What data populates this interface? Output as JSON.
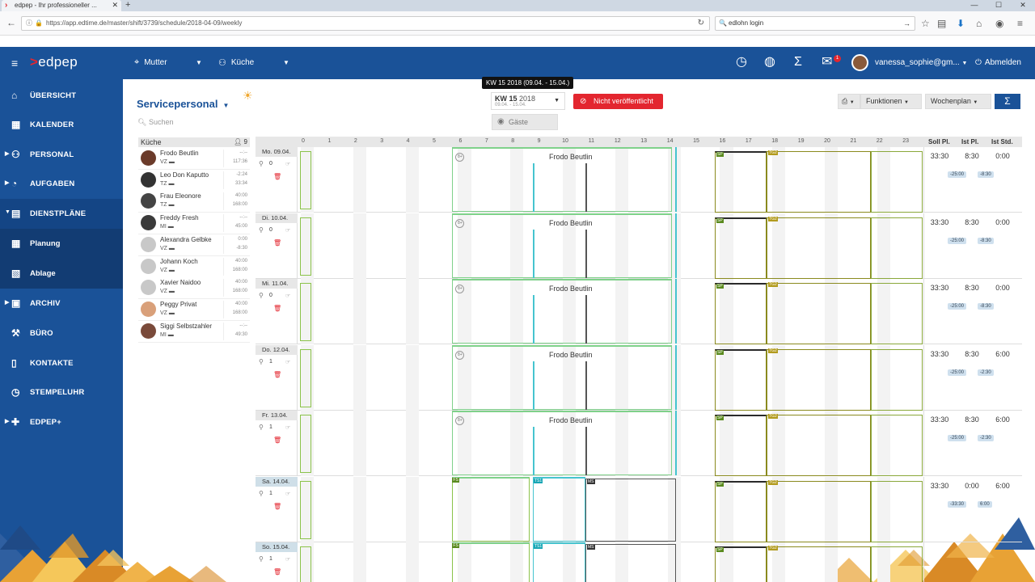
{
  "browser": {
    "tab_title": "edpep - Ihr professioneller ...",
    "new_tab": "+",
    "url": "https://app.edtime.de/master/shift/3739/schedule/2018-04-09/weekly",
    "search_text": "edlohn login"
  },
  "app": {
    "logo_prefix": ">",
    "logo_text": "edpep",
    "location": "Mutter",
    "department": "Küche",
    "notif_count": "1",
    "user": "vanessa_sophie@gm...",
    "logout": "Abmelden"
  },
  "sidebar": {
    "items": [
      {
        "label": "ÜBERSICHT",
        "icon": "home-icon"
      },
      {
        "label": "KALENDER",
        "icon": "calendar-icon"
      },
      {
        "label": "PERSONAL",
        "icon": "people-icon"
      },
      {
        "label": "AUFGABEN",
        "icon": "tasks-icon"
      },
      {
        "label": "DIENSTPLÄNE",
        "icon": "schedule-icon"
      },
      {
        "label": "Planung",
        "icon": "planning-icon"
      },
      {
        "label": "Ablage",
        "icon": "archive-tray-icon"
      },
      {
        "label": "ARCHIV",
        "icon": "archive-icon"
      },
      {
        "label": "BÜRO",
        "icon": "office-icon"
      },
      {
        "label": "KONTAKTE",
        "icon": "contacts-icon"
      },
      {
        "label": "STEMPELUHR",
        "icon": "clock-icon"
      },
      {
        "label": "EDPEP+",
        "icon": "plus-icon"
      }
    ]
  },
  "main": {
    "title": "Servicepersonal",
    "search_placeholder": "Suchen",
    "tooltip": "KW 15 2018 (09.04. - 15.04.)",
    "week_kw": "KW 15",
    "week_year": "2018",
    "week_range": "09.04. - 15.04.",
    "guests": "Gäste",
    "publish": "Nicht veröffentlicht",
    "functions": "Funktionen",
    "view": "Wochenplan"
  },
  "employees": {
    "group": "Küche",
    "count": "9",
    "list": [
      {
        "name": "Frodo Beutlin",
        "contract": "VZ",
        "v1": "--:--",
        "v2": "117:36"
      },
      {
        "name": "Leo Don Kaputto",
        "contract": "TZ",
        "v1": "-2:24",
        "v2": "33:34"
      },
      {
        "name": "Frau Eleonore",
        "contract": "TZ",
        "v1": "40:00",
        "v2": "168:00"
      },
      {
        "name": "Freddy Fresh",
        "contract": "MI",
        "v1": "--:--",
        "v2": "45:00"
      },
      {
        "name": "Alexandra Gelbke",
        "contract": "VZ",
        "v1": "0:00",
        "v2": "-8:30"
      },
      {
        "name": "Johann Koch",
        "contract": "VZ",
        "v1": "40:00",
        "v2": "168:00"
      },
      {
        "name": "Xavier Naidoo",
        "contract": "VZ",
        "v1": "40:00",
        "v2": "168:00"
      },
      {
        "name": "Peggy Privat",
        "contract": "VZ",
        "v1": "40:00",
        "v2": "168:00"
      },
      {
        "name": "Siggi Selbstzahler",
        "contract": "MI",
        "v1": "--:--",
        "v2": "49:30"
      }
    ]
  },
  "schedule": {
    "hours": [
      "0",
      "1",
      "2",
      "3",
      "4",
      "5",
      "6",
      "7",
      "8",
      "9",
      "10",
      "11",
      "12",
      "13",
      "14",
      "15",
      "16",
      "17",
      "18",
      "19",
      "20",
      "21",
      "22",
      "23"
    ],
    "col_soll": "Soll Pl.",
    "col_ist": "Ist Pl.",
    "col_std": "Ist Std.",
    "days": [
      {
        "label": "Mo. 09.04.",
        "count": "0",
        "shift": "Frodo Beutlin",
        "soll": "33:30",
        "ist": "8:30",
        "std": "0:00",
        "p1": "-25:00",
        "p2": "-8:30",
        "weekend": false
      },
      {
        "label": "Di. 10.04.",
        "count": "0",
        "shift": "Frodo Beutlin",
        "soll": "33:30",
        "ist": "8:30",
        "std": "0:00",
        "p1": "-25:00",
        "p2": "-8:30",
        "weekend": false
      },
      {
        "label": "Mi. 11.04.",
        "count": "0",
        "shift": "Frodo Beutlin",
        "soll": "33:30",
        "ist": "8:30",
        "std": "0:00",
        "p1": "-25:00",
        "p2": "-8:30",
        "weekend": false
      },
      {
        "label": "Do. 12.04.",
        "count": "1",
        "shift": "Frodo Beutlin",
        "soll": "33:30",
        "ist": "8:30",
        "std": "6:00",
        "p1": "-25:00",
        "p2": "-2:30",
        "weekend": false
      },
      {
        "label": "Fr. 13.04.",
        "count": "1",
        "shift": "Frodo Beutlin",
        "soll": "33:30",
        "ist": "8:30",
        "std": "6:00",
        "p1": "-25:00",
        "p2": "-2:30",
        "weekend": false
      },
      {
        "label": "Sa. 14.04.",
        "count": "1",
        "shift": "",
        "soll": "33:30",
        "ist": "0:00",
        "std": "6:00",
        "p1": "-33:30",
        "p2": "6:00",
        "weekend": true
      },
      {
        "label": "So. 15.04.",
        "count": "1",
        "shift": "",
        "soll": "",
        "ist": "",
        "std": "",
        "p1": "",
        "p2": "",
        "weekend": true
      }
    ],
    "tags": {
      "sp": "SP",
      "tg": "TG2",
      "ts": "TS1",
      "ms": "MS",
      "fs": "FS"
    }
  }
}
